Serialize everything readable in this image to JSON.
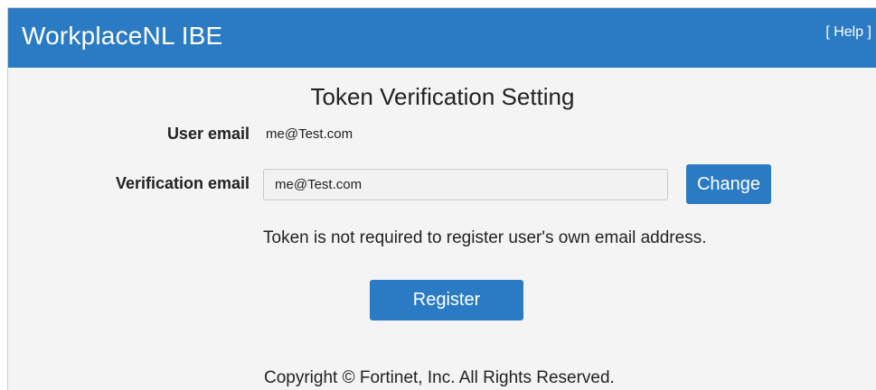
{
  "header": {
    "app_title": "WorkplaceNL IBE",
    "help_label": "[ Help ]"
  },
  "page": {
    "title": "Token Verification Setting"
  },
  "form": {
    "user_email_label": "User email",
    "user_email_value": "me@Test.com",
    "verification_email_label": "Verification email",
    "verification_email_value": "me@Test.com",
    "change_button_label": "Change",
    "info_text": "Token is not required to register user's own email address.",
    "register_button_label": "Register"
  },
  "footer": {
    "copyright": "Copyright © Fortinet, Inc. All Rights Reserved."
  },
  "colors": {
    "header_bg": "#2b7bc4",
    "button_bg": "#2b7bc4",
    "page_bg": "#f4f4f4"
  }
}
